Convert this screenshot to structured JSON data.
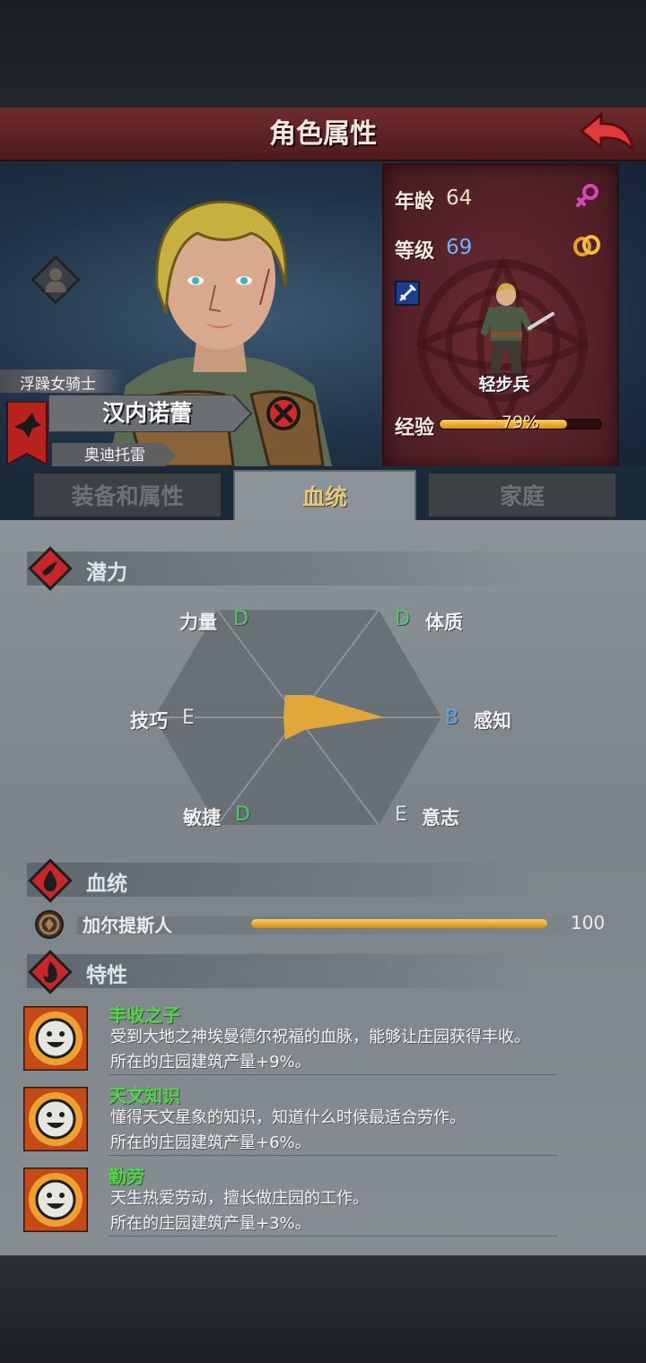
{
  "screen": {
    "title": "角色属性"
  },
  "character": {
    "title": "浮躁女骑士",
    "name": "汉内诺蕾",
    "house": "奥迪托雷",
    "age_label": "年龄",
    "age": "64",
    "level_label": "等级",
    "level": "69",
    "unit": "轻步兵",
    "exp_label": "经验",
    "exp_text": "79%",
    "exp_fraction": 0.79
  },
  "tabs": [
    {
      "label": "装备和属性",
      "active": false
    },
    {
      "label": "血统",
      "active": true
    },
    {
      "label": "家庭",
      "active": false
    }
  ],
  "potential": {
    "heading": "潜力",
    "stats": [
      {
        "label": "力量",
        "grade": "D",
        "value": 0.18
      },
      {
        "label": "体质",
        "grade": "D",
        "value": 0.18
      },
      {
        "label": "感知",
        "grade": "B",
        "value": 0.6
      },
      {
        "label": "意志",
        "grade": "E",
        "value": 0.1
      },
      {
        "label": "敏捷",
        "grade": "D",
        "value": 0.18
      },
      {
        "label": "技巧",
        "grade": "E",
        "value": 0.1
      }
    ]
  },
  "bloodline": {
    "heading": "血统",
    "name": "加尔提斯人",
    "value": "100",
    "fraction": 1.0
  },
  "traits": {
    "heading": "特性",
    "items": [
      {
        "name": "丰收之子",
        "desc": "受到大地之神埃曼德尔祝福的血脉，能够让庄园获得丰收。",
        "effect": "所在的庄园建筑产量+9%。"
      },
      {
        "name": "天文知识",
        "desc": "懂得天文星象的知识，知道什么时候最适合劳作。",
        "effect": "所在的庄园建筑产量+6%。"
      },
      {
        "name": "勤劳",
        "desc": "天生热爱劳动，擅长做庄园的工作。",
        "effect": "所在的庄园建筑产量+3%。"
      }
    ]
  },
  "colors": {
    "grade_D": "#4fc86a",
    "grade_E": "#e2e2e2",
    "grade_B": "#5fa8f0",
    "age_value": "#e8e2c8",
    "level_value": "#6fb6ff",
    "potential_fill": "#e0a83a"
  },
  "icons": {
    "back": "back-arrow-icon",
    "gender": "female-icon",
    "ring": "ring-icon",
    "weapon": "sword-icon",
    "close": "close-icon",
    "class": "knight-class-icon",
    "flag": "raven-banner-icon",
    "potential": "potential-icon",
    "bloodline": "blood-drop-icon",
    "traits": "flame-icon",
    "bloodline_emblem": "garthis-emblem-icon",
    "trait": "smiling-sun-icon"
  }
}
